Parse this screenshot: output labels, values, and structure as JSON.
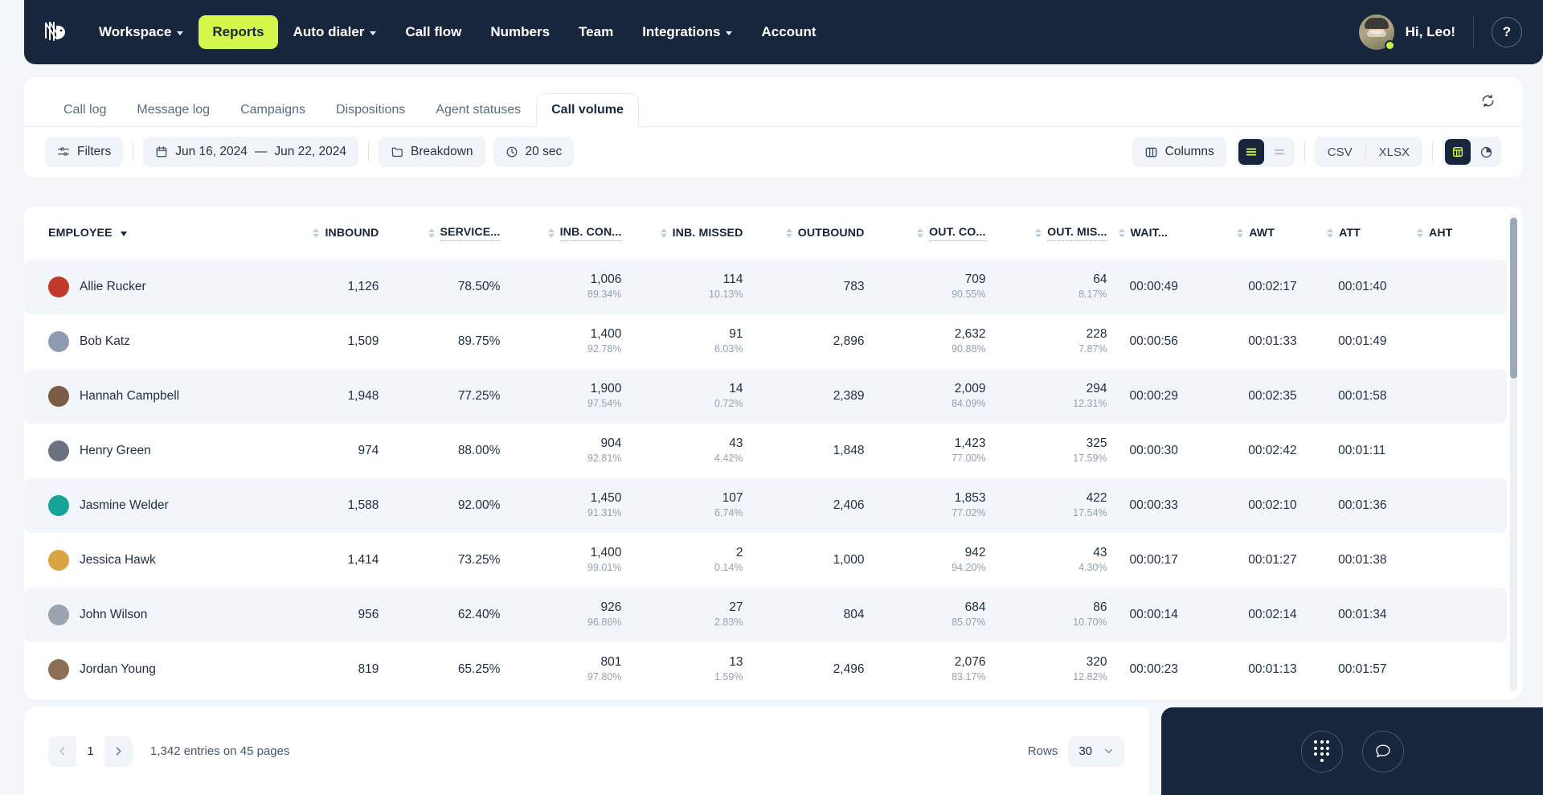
{
  "brand": {
    "logo_icon": "wing-logo-icon",
    "accent": "#d6f84c",
    "dark": "#17263c"
  },
  "nav": {
    "items": [
      {
        "label": "Workspace",
        "has_caret": true,
        "active": false
      },
      {
        "label": "Reports",
        "has_caret": false,
        "active": true
      },
      {
        "label": "Auto dialer",
        "has_caret": true,
        "active": false
      },
      {
        "label": "Call flow",
        "has_caret": false,
        "active": false
      },
      {
        "label": "Numbers",
        "has_caret": false,
        "active": false
      },
      {
        "label": "Team",
        "has_caret": false,
        "active": false
      },
      {
        "label": "Integrations",
        "has_caret": true,
        "active": false
      },
      {
        "label": "Account",
        "has_caret": false,
        "active": false
      }
    ],
    "greeting": "Hi, Leo!",
    "help_label": "?"
  },
  "tabs": [
    {
      "label": "Call log",
      "active": false
    },
    {
      "label": "Message log",
      "active": false
    },
    {
      "label": "Campaigns",
      "active": false
    },
    {
      "label": "Dispositions",
      "active": false
    },
    {
      "label": "Agent statuses",
      "active": false
    },
    {
      "label": "Call volume",
      "active": true
    }
  ],
  "toolbar": {
    "filters_label": "Filters",
    "date_start": "Jun 16, 2024",
    "date_sep": "—",
    "date_end": "Jun 22, 2024",
    "breakdown_label": "Breakdown",
    "interval_label": "20 sec",
    "columns_label": "Columns",
    "csv_label": "CSV",
    "xlsx_label": "XLSX"
  },
  "table": {
    "columns": [
      {
        "key": "employee",
        "label": "EMPLOYEE",
        "align": "left",
        "sortable": false,
        "sorted": true,
        "truncated": false
      },
      {
        "key": "inbound",
        "label": "INBOUND",
        "align": "right",
        "sortable": true,
        "truncated": false
      },
      {
        "key": "service",
        "label": "SERVICE...",
        "align": "right",
        "sortable": true,
        "truncated": true
      },
      {
        "key": "inb_con",
        "label": "INB. CON...",
        "align": "right",
        "sortable": true,
        "truncated": true
      },
      {
        "key": "inb_missed",
        "label": "INB. MISSED",
        "align": "right",
        "sortable": true,
        "truncated": false
      },
      {
        "key": "outbound",
        "label": "OUTBOUND",
        "align": "right",
        "sortable": true,
        "truncated": false
      },
      {
        "key": "out_co",
        "label": "OUT. CO...",
        "align": "right",
        "sortable": true,
        "truncated": true
      },
      {
        "key": "out_mis",
        "label": "OUT. MIS...",
        "align": "right",
        "sortable": true,
        "truncated": true
      },
      {
        "key": "wait",
        "label": "WAIT...",
        "align": "left",
        "sortable": true,
        "truncated": false
      },
      {
        "key": "awt",
        "label": "AWT",
        "align": "left",
        "sortable": true,
        "truncated": false
      },
      {
        "key": "att",
        "label": "ATT",
        "align": "left",
        "sortable": true,
        "truncated": false
      },
      {
        "key": "aht",
        "label": "AHT",
        "align": "left",
        "sortable": true,
        "truncated": false
      }
    ],
    "rows": [
      {
        "employee": "Allie Rucker",
        "avatar_color": "#c0392b",
        "inbound": "1,126",
        "service": "78.50%",
        "inb_con": "1,006",
        "inb_con_pct": "89.34%",
        "inb_missed": "114",
        "inb_missed_pct": "10.13%",
        "outbound": "783",
        "out_co": "709",
        "out_co_pct": "90.55%",
        "out_mis": "64",
        "out_mis_pct": "8.17%",
        "wait": "00:00:49",
        "awt": "00:02:17",
        "att": "00:01:40",
        "aht": ""
      },
      {
        "employee": "Bob Katz",
        "avatar_color": "#8f9bb3",
        "inbound": "1,509",
        "service": "89.75%",
        "inb_con": "1,400",
        "inb_con_pct": "92.78%",
        "inb_missed": "91",
        "inb_missed_pct": "6.03%",
        "outbound": "2,896",
        "out_co": "2,632",
        "out_co_pct": "90.88%",
        "out_mis": "228",
        "out_mis_pct": "7.87%",
        "wait": "00:00:56",
        "awt": "00:01:33",
        "att": "00:01:49",
        "aht": ""
      },
      {
        "employee": "Hannah Campbell",
        "avatar_color": "#7a5c44",
        "inbound": "1,948",
        "service": "77.25%",
        "inb_con": "1,900",
        "inb_con_pct": "97.54%",
        "inb_missed": "14",
        "inb_missed_pct": "0.72%",
        "outbound": "2,389",
        "out_co": "2,009",
        "out_co_pct": "84.09%",
        "out_mis": "294",
        "out_mis_pct": "12.31%",
        "wait": "00:00:29",
        "awt": "00:02:35",
        "att": "00:01:58",
        "aht": ""
      },
      {
        "employee": "Henry Green",
        "avatar_color": "#6b7280",
        "inbound": "974",
        "service": "88.00%",
        "inb_con": "904",
        "inb_con_pct": "92.81%",
        "inb_missed": "43",
        "inb_missed_pct": "4.42%",
        "outbound": "1,848",
        "out_co": "1,423",
        "out_co_pct": "77.00%",
        "out_mis": "325",
        "out_mis_pct": "17.59%",
        "wait": "00:00:30",
        "awt": "00:02:42",
        "att": "00:01:11",
        "aht": ""
      },
      {
        "employee": "Jasmine Welder",
        "avatar_color": "#17a398",
        "inbound": "1,588",
        "service": "92.00%",
        "inb_con": "1,450",
        "inb_con_pct": "91.31%",
        "inb_missed": "107",
        "inb_missed_pct": "6.74%",
        "outbound": "2,406",
        "out_co": "1,853",
        "out_co_pct": "77.02%",
        "out_mis": "422",
        "out_mis_pct": "17.54%",
        "wait": "00:00:33",
        "awt": "00:02:10",
        "att": "00:01:36",
        "aht": ""
      },
      {
        "employee": "Jessica Hawk",
        "avatar_color": "#d9a441",
        "inbound": "1,414",
        "service": "73.25%",
        "inb_con": "1,400",
        "inb_con_pct": "99.01%",
        "inb_missed": "2",
        "inb_missed_pct": "0.14%",
        "outbound": "1,000",
        "out_co": "942",
        "out_co_pct": "94.20%",
        "out_mis": "43",
        "out_mis_pct": "4.30%",
        "wait": "00:00:17",
        "awt": "00:01:27",
        "att": "00:01:38",
        "aht": ""
      },
      {
        "employee": "John Wilson",
        "avatar_color": "#9aa5b1",
        "inbound": "956",
        "service": "62.40%",
        "inb_con": "926",
        "inb_con_pct": "96.86%",
        "inb_missed": "27",
        "inb_missed_pct": "2.83%",
        "outbound": "804",
        "out_co": "684",
        "out_co_pct": "85.07%",
        "out_mis": "86",
        "out_mis_pct": "10.70%",
        "wait": "00:00:14",
        "awt": "00:02:14",
        "att": "00:01:34",
        "aht": ""
      },
      {
        "employee": "Jordan Young",
        "avatar_color": "#8c6f55",
        "inbound": "819",
        "service": "65.25%",
        "inb_con": "801",
        "inb_con_pct": "97.80%",
        "inb_missed": "13",
        "inb_missed_pct": "1.59%",
        "outbound": "2,496",
        "out_co": "2,076",
        "out_co_pct": "83.17%",
        "out_mis": "320",
        "out_mis_pct": "12.82%",
        "wait": "00:00:23",
        "awt": "00:01:13",
        "att": "00:01:57",
        "aht": ""
      }
    ]
  },
  "footer": {
    "page_number": "1",
    "entries_text": "1,342 entries on 45 pages",
    "rows_label": "Rows",
    "rows_value": "30"
  }
}
